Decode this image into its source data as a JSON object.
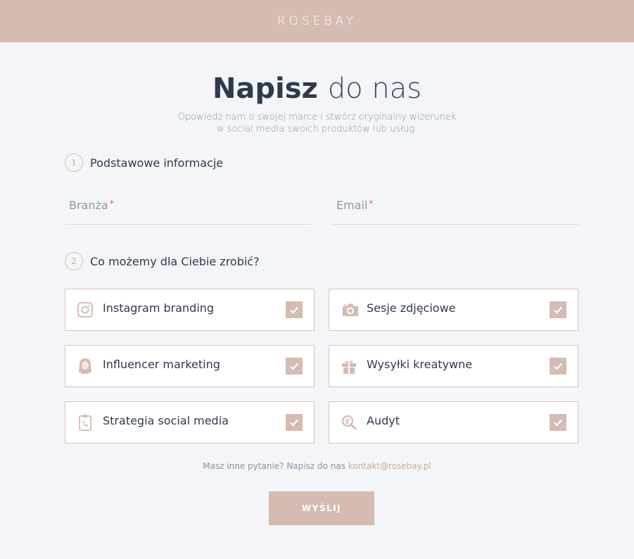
{
  "header": {
    "logo_text": "ROSEBAY"
  },
  "hero": {
    "title_bold": "Napisz",
    "title_light": "do nas",
    "subtitle_line1": "Opowiedz nam o swojej marce i stwórz oryginalny wizerunek",
    "subtitle_line2": "w social media swoich produktów lub usług."
  },
  "step1": {
    "number": "1",
    "label": "Podstawowe informacje"
  },
  "fields": {
    "branza": {
      "label": "Branża",
      "required_mark": "*",
      "value": ""
    },
    "email": {
      "label": "Email",
      "required_mark": "*",
      "value": ""
    }
  },
  "step2": {
    "number": "2",
    "label": "Co możemy dla Ciebie zrobić?"
  },
  "options": [
    {
      "label": "Instagram branding",
      "icon": "instagram-icon",
      "checked": true
    },
    {
      "label": "Sesje zdjęciowe",
      "icon": "camera-icon",
      "checked": true
    },
    {
      "label": "Influencer marketing",
      "icon": "influencer-icon",
      "checked": true
    },
    {
      "label": "Wysyłki kreatywne",
      "icon": "gift-icon",
      "checked": true
    },
    {
      "label": "Strategia social media",
      "icon": "clipboard-phone-icon",
      "checked": true
    },
    {
      "label": "Audyt",
      "icon": "magnifier-icon",
      "checked": true
    }
  ],
  "footer": {
    "question": "Masz inne pytanie? Napisz do nas",
    "email_link": "kontakt@rosebay.pl"
  },
  "submit": {
    "label": "WYŚLIJ"
  },
  "colors": {
    "accent": "#d5bbb2",
    "background": "#f4f5f9",
    "text": "#2f3a4d",
    "required": "#e0675f"
  }
}
